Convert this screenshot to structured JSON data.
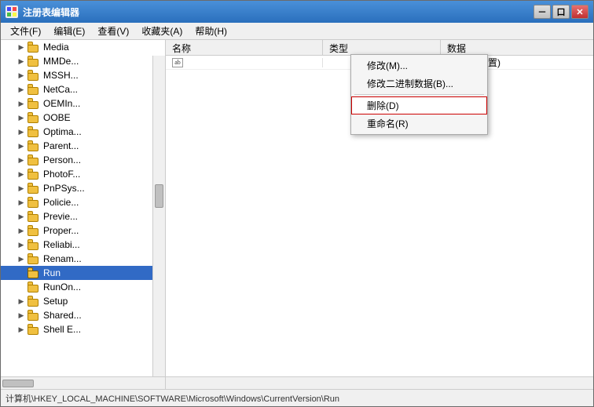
{
  "window": {
    "title": "注册表编辑器",
    "icon": "reg"
  },
  "titlebar": {
    "minimize": "－",
    "restore": "口",
    "close": "✕"
  },
  "menubar": {
    "items": [
      {
        "label": "文件(F)"
      },
      {
        "label": "编辑(E)"
      },
      {
        "label": "查看(V)"
      },
      {
        "label": "收藏夹(A)"
      },
      {
        "label": "帮助(H)"
      }
    ]
  },
  "tree": {
    "header": "名称",
    "items": [
      {
        "label": "Media",
        "indent": 1,
        "hasChildren": true
      },
      {
        "label": "MMDe...",
        "indent": 1,
        "hasChildren": true
      },
      {
        "label": "MSSH...",
        "indent": 1,
        "hasChildren": true
      },
      {
        "label": "NetCa...",
        "indent": 1,
        "hasChildren": true
      },
      {
        "label": "OEMIn...",
        "indent": 1,
        "hasChildren": true
      },
      {
        "label": "OOBE",
        "indent": 1,
        "hasChildren": true
      },
      {
        "label": "Optima...",
        "indent": 1,
        "hasChildren": true
      },
      {
        "label": "Parent...",
        "indent": 1,
        "hasChildren": true
      },
      {
        "label": "Person...",
        "indent": 1,
        "hasChildren": true
      },
      {
        "label": "PhotoF...",
        "indent": 1,
        "hasChildren": true
      },
      {
        "label": "PnPSys...",
        "indent": 1,
        "hasChildren": true
      },
      {
        "label": "Policie...",
        "indent": 1,
        "hasChildren": true
      },
      {
        "label": "Previe...",
        "indent": 1,
        "hasChildren": true
      },
      {
        "label": "Proper...",
        "indent": 1,
        "hasChildren": true
      },
      {
        "label": "Reliabi...",
        "indent": 1,
        "hasChildren": true
      },
      {
        "label": "Renam...",
        "indent": 1,
        "hasChildren": true
      },
      {
        "label": "Run",
        "indent": 1,
        "hasChildren": false,
        "selected": true
      },
      {
        "label": "RunOn...",
        "indent": 1,
        "hasChildren": false
      },
      {
        "label": "Setup",
        "indent": 1,
        "hasChildren": true
      },
      {
        "label": "Shared...",
        "indent": 1,
        "hasChildren": true
      },
      {
        "label": "Shell E...",
        "indent": 1,
        "hasChildren": true
      }
    ]
  },
  "columns": {
    "name": "名称",
    "type": "类型",
    "data": "数据"
  },
  "registry_entries": [
    {
      "name": "ab",
      "type": "",
      "data": "(数值未设置)"
    }
  ],
  "context_menu": {
    "items": [
      {
        "label": "修改(M)...",
        "type": "normal"
      },
      {
        "label": "修改二进制数据(B)...",
        "type": "normal"
      },
      {
        "label": "separator"
      },
      {
        "label": "删除(D)",
        "type": "highlighted"
      },
      {
        "label": "重命名(R)",
        "type": "normal"
      }
    ]
  },
  "status_bar": {
    "path": "计算机\\HKEY_LOCAL_MACHINE\\SOFTWARE\\Microsoft\\Windows\\CurrentVersion\\Run"
  }
}
